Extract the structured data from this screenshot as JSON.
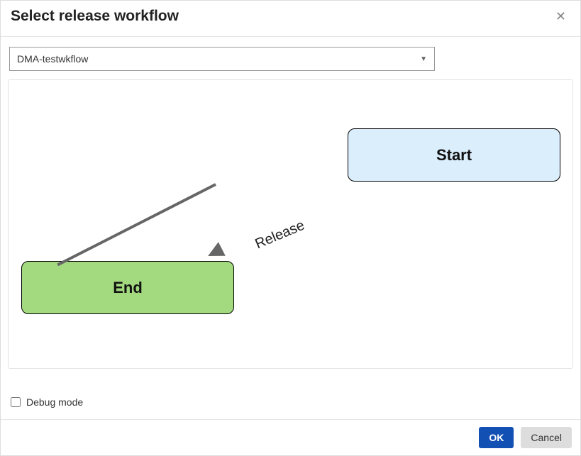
{
  "dialog": {
    "title": "Select release workflow"
  },
  "dropdown": {
    "selected": "DMA-testwkflow"
  },
  "workflow": {
    "nodes": {
      "start": {
        "label": "Start"
      },
      "end": {
        "label": "End"
      }
    },
    "edges": {
      "release": {
        "label": "Release"
      }
    }
  },
  "debug": {
    "label": "Debug mode",
    "checked": false
  },
  "buttons": {
    "ok": "OK",
    "cancel": "Cancel"
  }
}
